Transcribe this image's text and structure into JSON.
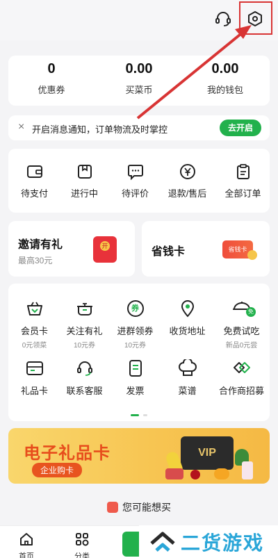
{
  "header": {
    "icons": [
      "headset-icon",
      "settings-icon"
    ]
  },
  "stats": [
    {
      "value": "0",
      "label": "优惠券"
    },
    {
      "value": "0.00",
      "label": "买菜币"
    },
    {
      "value": "0.00",
      "label": "我的钱包"
    }
  ],
  "notice": {
    "close": "×",
    "text": "开启消息通知，订单物流及时掌控",
    "button": "去开启"
  },
  "orders": [
    {
      "label": "待支付",
      "icon": "wallet-icon"
    },
    {
      "label": "进行中",
      "icon": "box-icon"
    },
    {
      "label": "待评价",
      "icon": "comment-icon"
    },
    {
      "label": "退款/售后",
      "icon": "refund-icon"
    },
    {
      "label": "全部订单",
      "icon": "clipboard-icon"
    }
  ],
  "promos": {
    "invite": {
      "title": "邀请有礼",
      "sub": "最高30元",
      "badge": "开"
    },
    "save": {
      "title": "省钱卡",
      "badge": "省钱卡"
    }
  },
  "services": [
    {
      "label": "会员卡",
      "sub": "0元领菜",
      "icon": "basket-icon"
    },
    {
      "label": "关注有礼",
      "sub": "10元券",
      "icon": "pot-icon"
    },
    {
      "label": "进群领券",
      "sub": "10元券",
      "icon": "coupon-icon",
      "icon_text": "券"
    },
    {
      "label": "收货地址",
      "sub": "",
      "icon": "location-icon"
    },
    {
      "label": "免费试吃",
      "sub": "新品0元尝",
      "icon": "free-tasting-icon",
      "icon_text": "免"
    },
    {
      "label": "礼品卡",
      "sub": "",
      "icon": "gift-card-icon"
    },
    {
      "label": "联系客服",
      "sub": "",
      "icon": "headset-icon"
    },
    {
      "label": "发票",
      "sub": "",
      "icon": "invoice-icon"
    },
    {
      "label": "菜谱",
      "sub": "",
      "icon": "chef-hat-icon"
    },
    {
      "label": "合作商招募",
      "sub": "",
      "icon": "handshake-icon"
    }
  ],
  "banner": {
    "title": "电子礼品卡",
    "tag": "企业购卡",
    "card_text": "VIP"
  },
  "maybe": {
    "text": "您可能想买"
  },
  "tabbar": [
    {
      "label": "首页",
      "icon": "home-icon"
    },
    {
      "label": "分类",
      "icon": "category-icon"
    }
  ],
  "watermark": {
    "text": "二货游戏园"
  },
  "colors": {
    "accent": "#22b14c",
    "annotation": "#d83434",
    "banner_text": "#e74d1c"
  }
}
